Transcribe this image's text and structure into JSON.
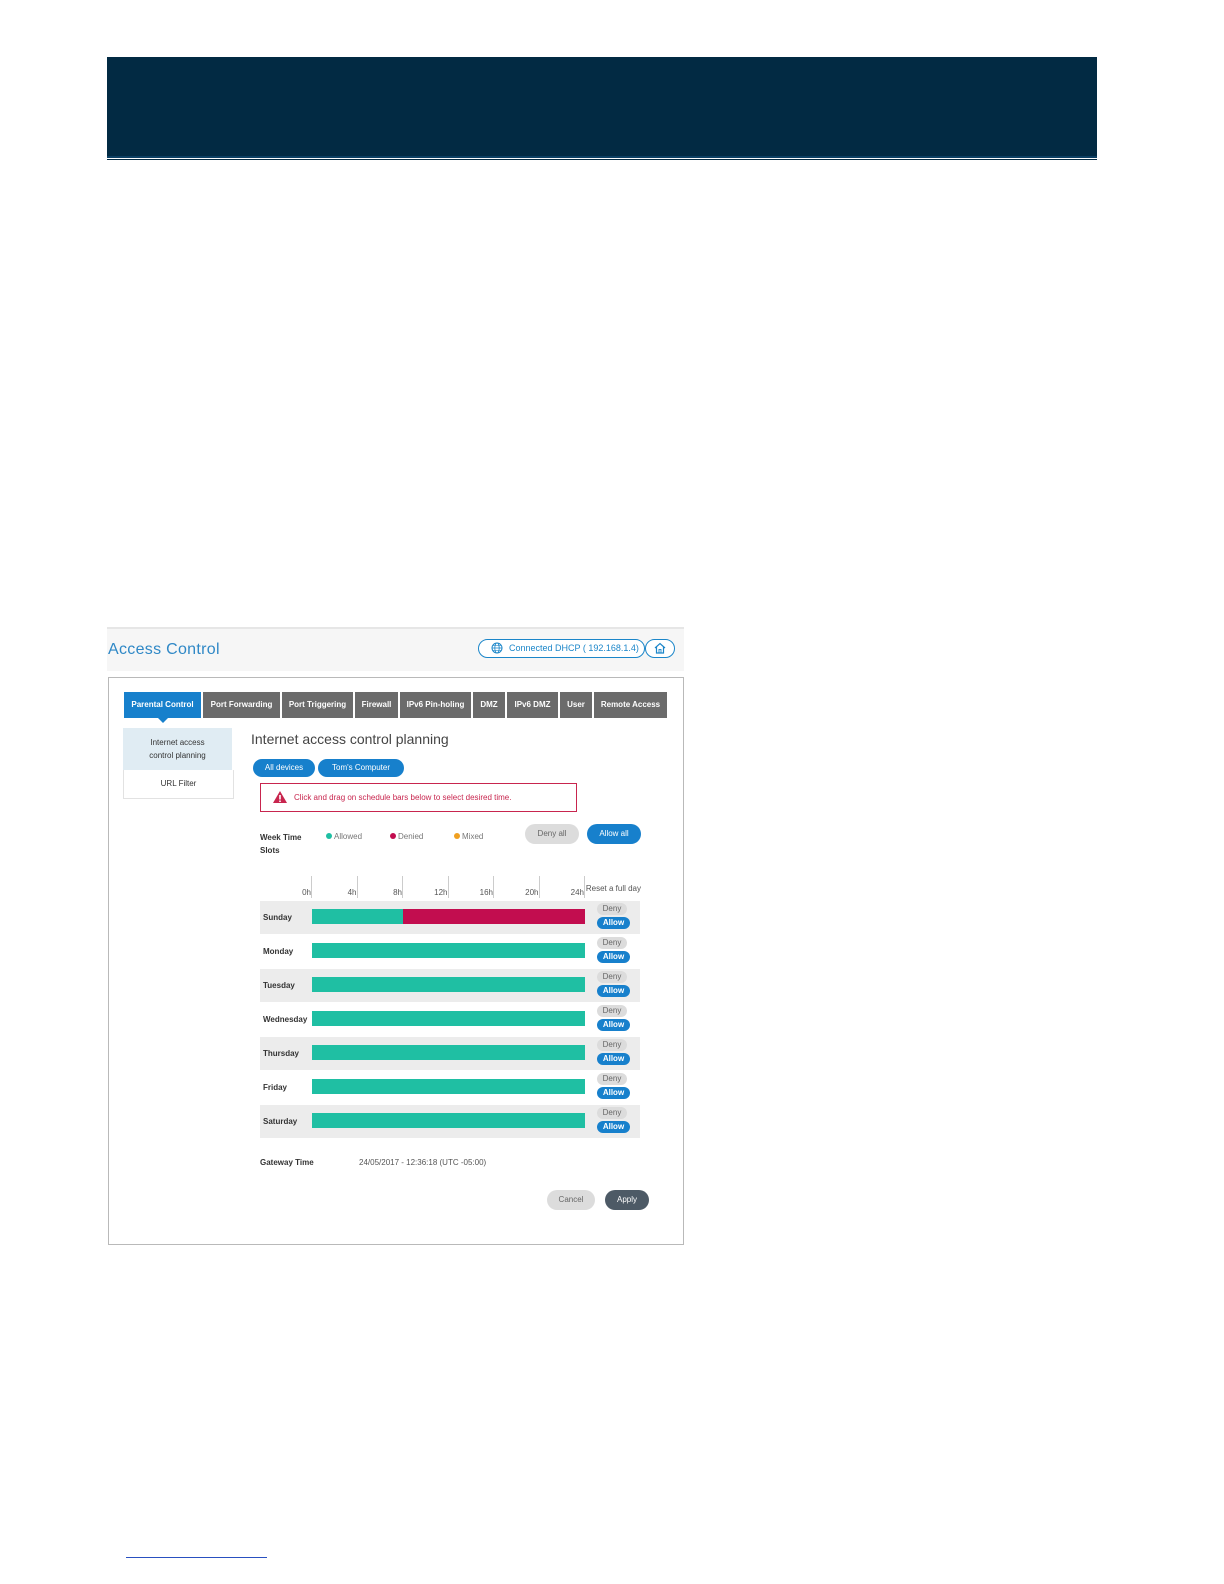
{
  "page_title": "Access Control",
  "status": {
    "text": "Connected  DHCP  ( 192.168.1.4)",
    "icon": "globe-icon"
  },
  "tabs": [
    {
      "label": "Parental Control",
      "active": true
    },
    {
      "label": "Port Forwarding",
      "active": false
    },
    {
      "label": "Port Triggering",
      "active": false
    },
    {
      "label": "Firewall",
      "active": false
    },
    {
      "label": "IPv6 Pin-holing",
      "active": false
    },
    {
      "label": "DMZ",
      "active": false
    },
    {
      "label": "IPv6 DMZ",
      "active": false
    },
    {
      "label": "User",
      "active": false
    },
    {
      "label": "Remote Access",
      "active": false
    }
  ],
  "sidebar": {
    "items": [
      {
        "label": "Internet access control planning",
        "active": true
      },
      {
        "label": "URL Filter",
        "active": false
      }
    ]
  },
  "main": {
    "section_title": "Internet access control planning",
    "devices": [
      "All devices",
      "Tom's Computer"
    ],
    "hint": "Click and drag on schedule bars below to select desired time.",
    "week_time_slots_label": "Week Time Slots",
    "legend": [
      {
        "label": "Allowed",
        "color": "#1fbfa3"
      },
      {
        "label": "Denied",
        "color": "#c20d4f"
      },
      {
        "label": "Mixed",
        "color": "#f0a020"
      }
    ],
    "deny_all_label": "Deny all",
    "allow_all_label": "Allow all",
    "hours": [
      "0h",
      "4h",
      "8h",
      "12h",
      "16h",
      "20h",
      "24h"
    ],
    "reset_label": "Reset a full day",
    "days": [
      {
        "name": "Sunday",
        "allowed_until_hour": 8,
        "denied_from_hour": 8,
        "deny": "Deny",
        "allow": "Allow"
      },
      {
        "name": "Monday",
        "allowed_until_hour": 24,
        "denied_from_hour": 24,
        "deny": "Deny",
        "allow": "Allow"
      },
      {
        "name": "Tuesday",
        "allowed_until_hour": 24,
        "denied_from_hour": 24,
        "deny": "Deny",
        "allow": "Allow"
      },
      {
        "name": "Wednesday",
        "allowed_until_hour": 24,
        "denied_from_hour": 24,
        "deny": "Deny",
        "allow": "Allow"
      },
      {
        "name": "Thursday",
        "allowed_until_hour": 24,
        "denied_from_hour": 24,
        "deny": "Deny",
        "allow": "Allow"
      },
      {
        "name": "Friday",
        "allowed_until_hour": 24,
        "denied_from_hour": 24,
        "deny": "Deny",
        "allow": "Allow"
      },
      {
        "name": "Saturday",
        "allowed_until_hour": 24,
        "denied_from_hour": 24,
        "deny": "Deny",
        "allow": "Allow"
      }
    ],
    "gateway_time_label": "Gateway Time",
    "gateway_time_value": "24/05/2017 - 12:36:18 (UTC -05:00)",
    "cancel_label": "Cancel",
    "apply_label": "Apply"
  }
}
